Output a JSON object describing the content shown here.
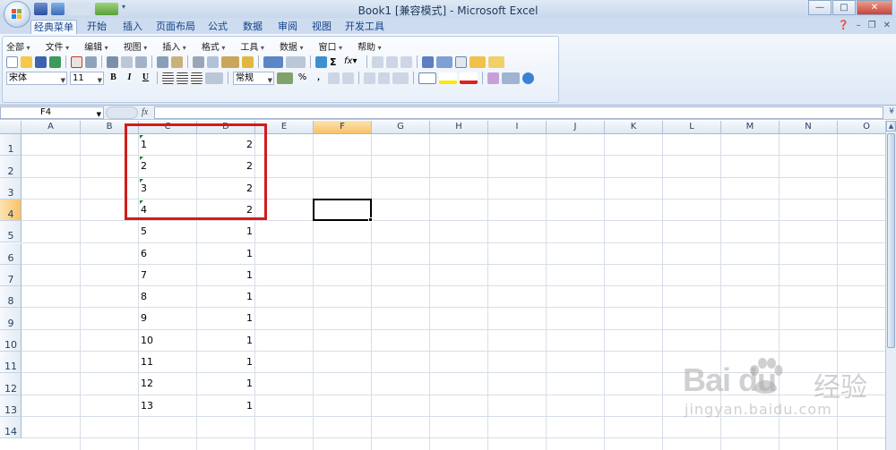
{
  "window": {
    "title": "Book1  [兼容模式] - Microsoft Excel",
    "minimize": "—",
    "maximize": "□",
    "close": "✕"
  },
  "ribbon_tabs": [
    {
      "label": "经典菜单",
      "active": true
    },
    {
      "label": "开始",
      "active": false
    },
    {
      "label": "插入",
      "active": false
    },
    {
      "label": "页面布局",
      "active": false
    },
    {
      "label": "公式",
      "active": false
    },
    {
      "label": "数据",
      "active": false
    },
    {
      "label": "审阅",
      "active": false
    },
    {
      "label": "视图",
      "active": false
    },
    {
      "label": "开发工具",
      "active": false
    }
  ],
  "classic_menu": [
    "全部",
    "文件",
    "编辑",
    "视图",
    "插入",
    "格式",
    "工具",
    "数据",
    "窗口",
    "帮助"
  ],
  "format_toolbar": {
    "font": "宋体",
    "size": "11",
    "bold": "B",
    "italic": "I",
    "underline": "U",
    "number_format": "常规",
    "percent": "%",
    "comma": ","
  },
  "formula_bar": {
    "name_box": "F4",
    "fx": "fx",
    "value": ""
  },
  "columns": [
    "A",
    "B",
    "C",
    "D",
    "E",
    "F",
    "G",
    "H",
    "I",
    "J",
    "K",
    "L",
    "M",
    "N",
    "O"
  ],
  "selected_column": "F",
  "rows": [
    "1",
    "2",
    "3",
    "4",
    "5",
    "6",
    "7",
    "8",
    "9",
    "10",
    "11",
    "12",
    "13",
    "14"
  ],
  "selected_row": "4",
  "cells": {
    "C": [
      "1",
      "2",
      "3",
      "4",
      "5",
      "6",
      "7",
      "8",
      "9",
      "10",
      "11",
      "12",
      "13"
    ],
    "D": [
      "2",
      "2",
      "2",
      "2",
      "1",
      "1",
      "1",
      "1",
      "1",
      "1",
      "1",
      "1",
      "1"
    ]
  },
  "text_number_indicator_rows": [
    "1",
    "2",
    "3",
    "4"
  ],
  "active_cell": "F4",
  "highlight": {
    "range": "C1:D4",
    "color": "#d11c1c"
  },
  "watermark": {
    "brand": "Bai  du",
    "cn": "经验",
    "url": "jingyan.baidu.com"
  }
}
